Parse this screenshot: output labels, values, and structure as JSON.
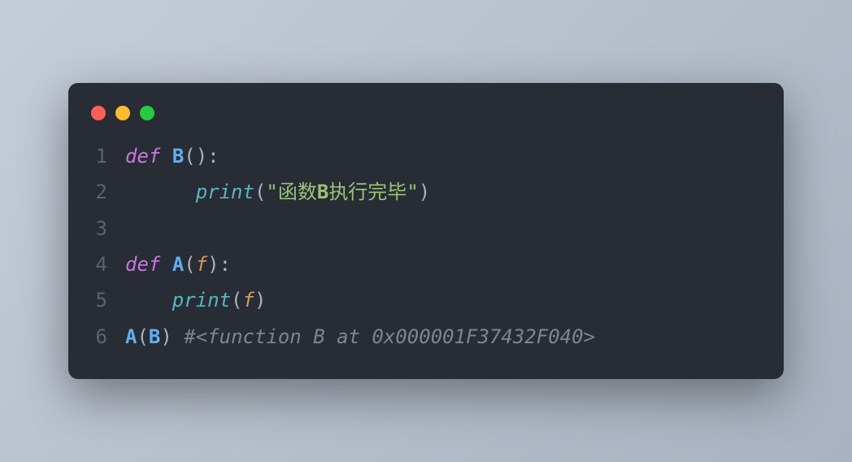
{
  "window": {
    "buttons": {
      "close": "close",
      "minimize": "minimize",
      "maximize": "maximize"
    }
  },
  "code": {
    "lines": [
      {
        "number": "1",
        "tokens": {
          "keyword": "def",
          "space1": " ",
          "funcname": "B",
          "parens": "():"
        }
      },
      {
        "number": "2",
        "tokens": {
          "indent": "      ",
          "builtin": "print",
          "open": "(",
          "quote1": "\"",
          "str_cjk1": "函数",
          "str_bold": "B",
          "str_cjk2": "执行完毕",
          "quote2": "\"",
          "close": ")"
        }
      },
      {
        "number": "3",
        "tokens": {}
      },
      {
        "number": "4",
        "tokens": {
          "keyword": "def",
          "space1": " ",
          "funcname": "A",
          "open": "(",
          "param": "f",
          "close": "):"
        }
      },
      {
        "number": "5",
        "tokens": {
          "indent": "    ",
          "builtin": "print",
          "open": "(",
          "param": "f",
          "close": ")"
        }
      },
      {
        "number": "6",
        "tokens": {
          "call": "A",
          "open": "(",
          "arg": "B",
          "close": ")",
          "space": " ",
          "comment": "#<function B at 0x000001F37432F040>"
        }
      }
    ]
  }
}
